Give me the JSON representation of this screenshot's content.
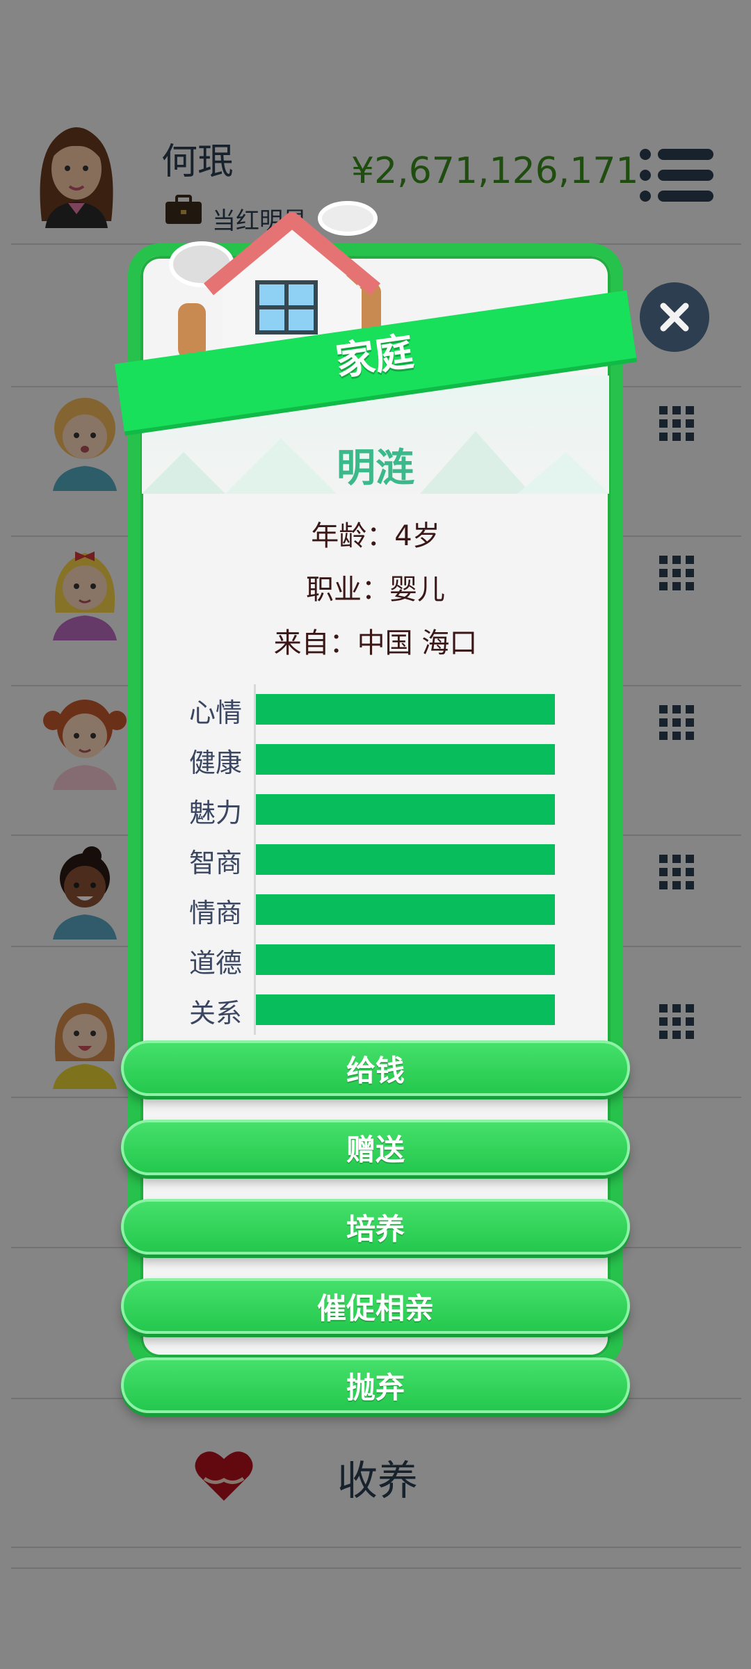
{
  "player": {
    "name": "何珉",
    "job": "当红明星",
    "money": "¥2,671,126,171"
  },
  "background_rows": [
    {
      "face": "girl-blonde-curly-avatar"
    },
    {
      "face": "girl-blonde-bow-avatar"
    },
    {
      "face": "girl-red-pigtails-avatar"
    },
    {
      "face": "girl-dark-bun-avatar"
    },
    {
      "face": "girl-brown-hair-avatar"
    }
  ],
  "adopt": {
    "label": "收养",
    "icon": "heart-hands-icon"
  },
  "modal": {
    "title": "家庭",
    "member_name": "明涟",
    "age_line": "年龄：4岁",
    "job_line": "职业：婴儿",
    "from_line": "来自：中国 海口",
    "stats": [
      {
        "label": "心情",
        "level": 1.0
      },
      {
        "label": "健康",
        "level": 1.0
      },
      {
        "label": "魅力",
        "level": 1.0
      },
      {
        "label": "智商",
        "level": 1.0
      },
      {
        "label": "情商",
        "level": 1.0
      },
      {
        "label": "道德",
        "level": 1.0
      },
      {
        "label": "关系",
        "level": 1.0
      }
    ],
    "actions": [
      "给钱",
      "赠送",
      "培养",
      "催促相亲",
      "抛弃"
    ]
  },
  "colors": {
    "accent_green": "#27c24c",
    "stat_bar": "#07bd5c",
    "money": "#3a8a1c",
    "name_teal": "#3bb98a"
  }
}
